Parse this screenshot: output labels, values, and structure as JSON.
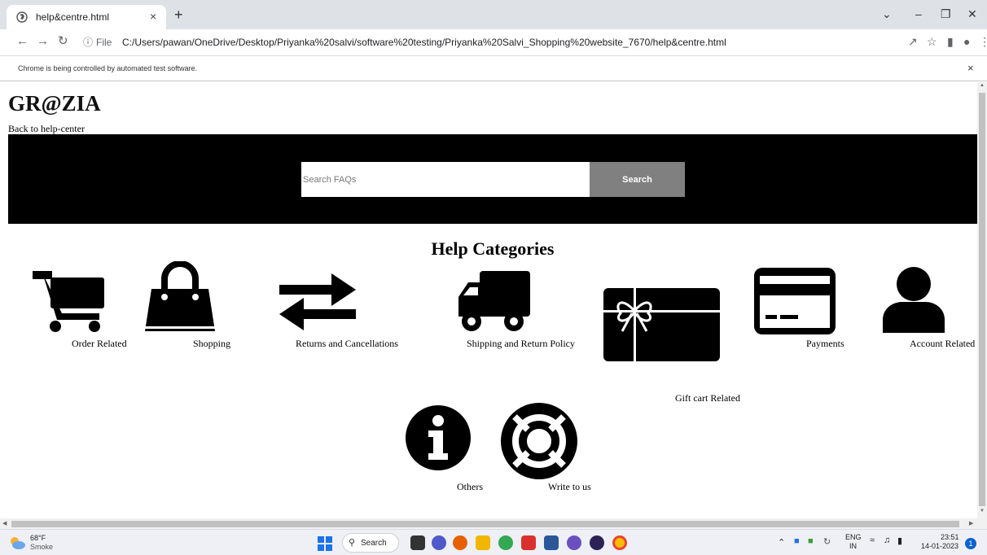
{
  "browser": {
    "tab_title": "help&centre.html",
    "tab_close": "×",
    "new_tab": "+",
    "address_scheme": "File",
    "address_url": "C:/Users/pawan/OneDrive/Desktop/Priyanka%20salvi/software%20testing/Priyanka%20Salvi_Shopping%20website_7670/help&centre.html",
    "infobar_text": "Chrome is being controlled by automated test software.",
    "infobar_close": "×"
  },
  "page": {
    "logo": "GR@ZIA",
    "back_link": "Back to help-center",
    "search": {
      "placeholder": "Search FAQs",
      "button_label": "Search"
    },
    "section_title": "Help Categories",
    "categories": [
      {
        "label": "Order Related",
        "icon": "cart-icon"
      },
      {
        "label": "Shopping",
        "icon": "shopping-bag-icon"
      },
      {
        "label": "Returns and Cancellations",
        "icon": "exchange-arrows-icon"
      },
      {
        "label": "Shipping and Return Policy",
        "icon": "truck-icon"
      },
      {
        "label": "Gift cart Related",
        "icon": "gift-card-icon"
      },
      {
        "label": "Payments",
        "icon": "credit-card-icon"
      },
      {
        "label": "Account Related",
        "icon": "user-icon"
      },
      {
        "label": "Others",
        "icon": "info-icon"
      },
      {
        "label": "Write to us",
        "icon": "life-ring-icon"
      }
    ]
  },
  "taskbar": {
    "weather_temp": "68°F",
    "weather_condition": "Smoke",
    "search_label": "Search",
    "language": "ENG",
    "region": "IN",
    "time": "23:51",
    "date": "14-01-2023",
    "notification_count": "1"
  }
}
